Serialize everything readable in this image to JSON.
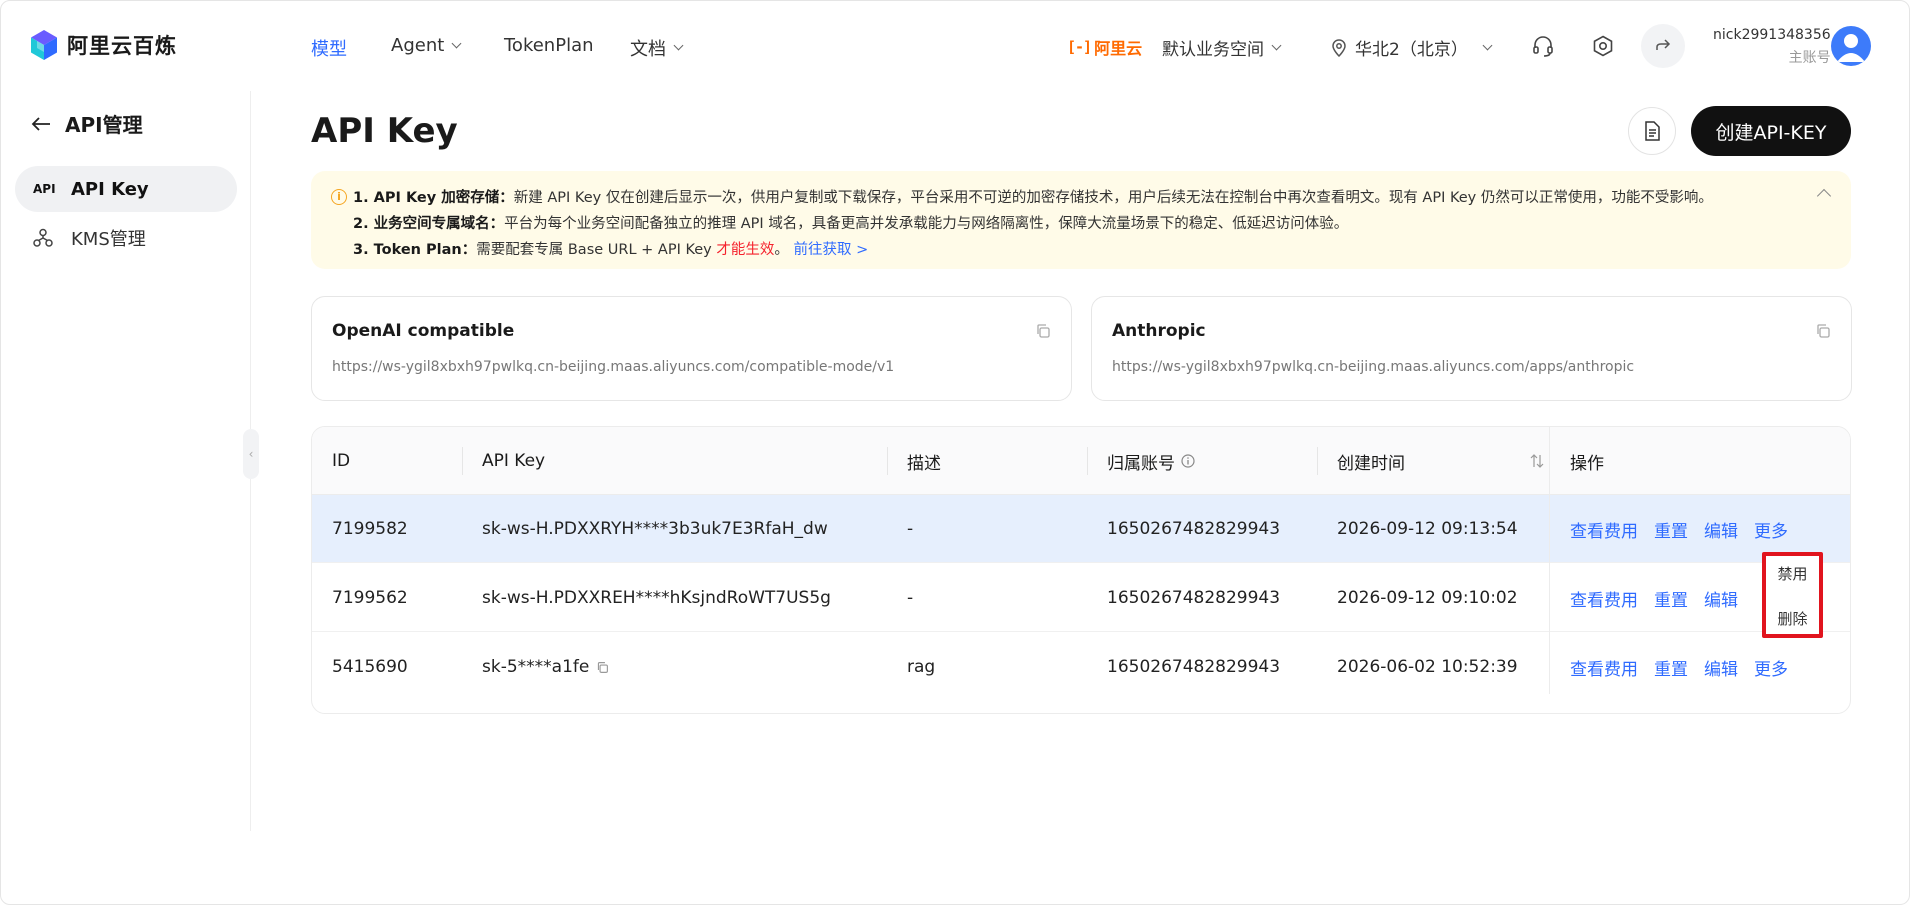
{
  "brand": {
    "name": "阿里云百炼"
  },
  "topnav": {
    "items": [
      {
        "label": "模型"
      },
      {
        "label": "Agent"
      },
      {
        "label": "TokenPlan"
      },
      {
        "label": "文档"
      }
    ],
    "aliyun_label": "阿里云",
    "workspace": "默认业务空间",
    "region": "华北2（北京）"
  },
  "user": {
    "name": "nick2991348356",
    "role": "主账号"
  },
  "sidebar": {
    "back_label": "API管理",
    "items": [
      {
        "label": "API Key",
        "icon_text": "API"
      },
      {
        "label": "KMS管理"
      }
    ]
  },
  "page": {
    "title": "API Key",
    "create_button": "创建API-KEY"
  },
  "notice": {
    "line1_title": "1. API Key 加密存储：",
    "line1_text": "新建 API Key 仅在创建后显示一次，供用户复制或下载保存，平台采用不可逆的加密存储技术，用户后续无法在控制台中再次查看明文。现有 API Key 仍然可以正常使用，功能不受影响。",
    "line2_title": "2. 业务空间专属域名：",
    "line2_text": "平台为每个业务空间配备独立的推理 API 域名，具备更高并发承载能力与网络隔离性，保障大流量场景下的稳定、低延迟访问体验。",
    "line3_title": "3. Token Plan：",
    "line3_text": "需要配套专属 Base URL + API Key ",
    "line3_red": "才能生效",
    "line3_end": "。 ",
    "line3_link": "前往获取 >"
  },
  "endpoints": [
    {
      "title": "OpenAI compatible",
      "url": "https://ws-ygil8xbxh97pwlkq.cn-beijing.maas.aliyuncs.com/compatible-mode/v1"
    },
    {
      "title": "Anthropic",
      "url": "https://ws-ygil8xbxh97pwlkq.cn-beijing.maas.aliyuncs.com/apps/anthropic"
    }
  ],
  "table": {
    "headers": {
      "id": "ID",
      "key": "API Key",
      "desc": "描述",
      "account": "归属账号",
      "created": "创建时间",
      "ops": "操作"
    },
    "rows": [
      {
        "id": "7199582",
        "key": "sk-ws-H.PDXXRYH****3b3uk7E3RfaH_dw",
        "desc": "-",
        "account": "1650267482829943",
        "created": "2026-09-12 09:13:54"
      },
      {
        "id": "7199562",
        "key": "sk-ws-H.PDXXREH****hKsjndRoWT7US5g",
        "desc": "-",
        "account": "1650267482829943",
        "created": "2026-09-12 09:10:02"
      },
      {
        "id": "5415690",
        "key": "sk-5****a1fe",
        "desc": "rag",
        "account": "1650267482829943",
        "created": "2026-06-02 10:52:39"
      }
    ],
    "actions": {
      "cost": "查看费用",
      "reset": "重置",
      "edit": "编辑",
      "more": "更多"
    }
  },
  "dropdown": {
    "items": [
      "禁用",
      "删除"
    ]
  }
}
